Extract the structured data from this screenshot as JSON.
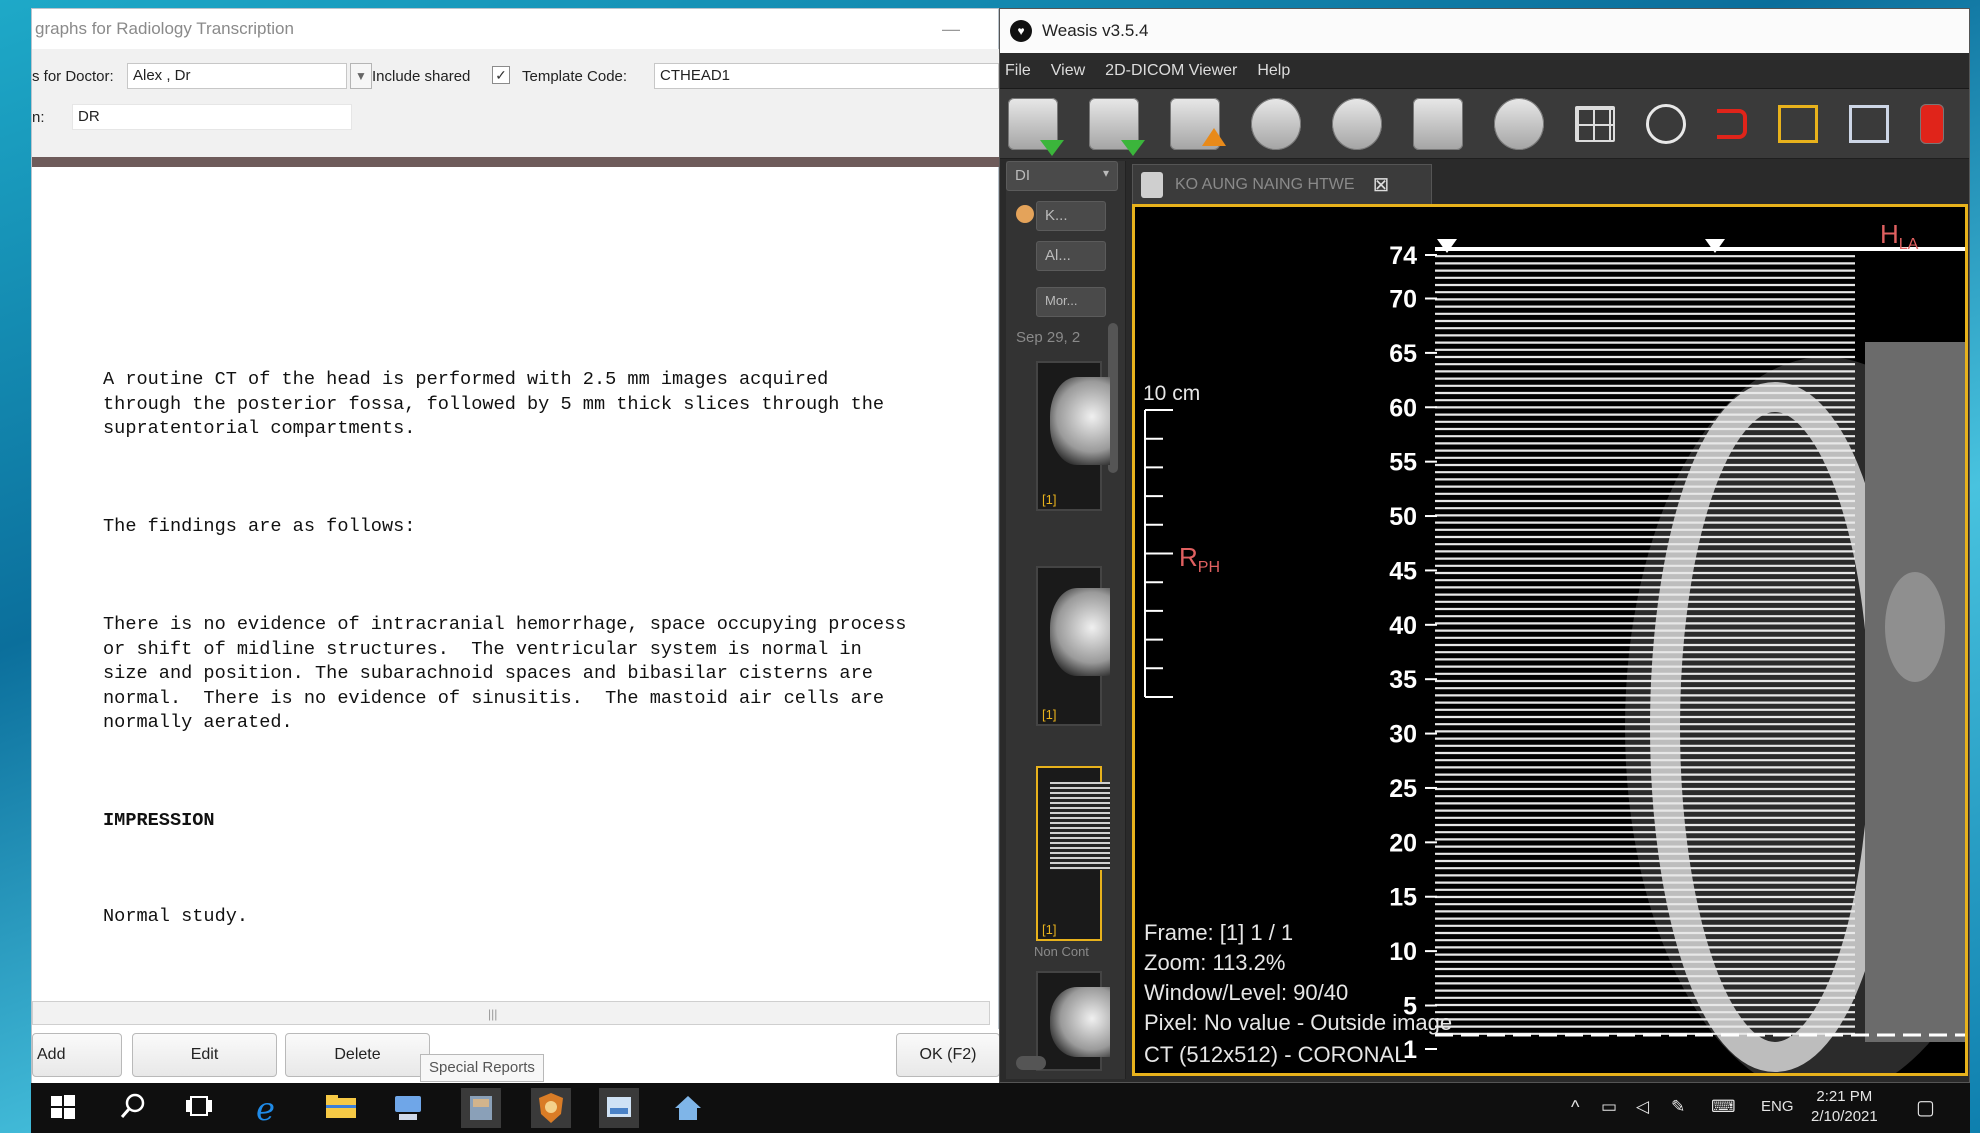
{
  "left_window": {
    "title": "graphs for Radiology Transcription",
    "minimize": "—",
    "doctor_label": "s for Doctor:",
    "doctor_value": "Alex , Dr",
    "include_shared_label": "Include shared",
    "include_shared_checked": "✓",
    "template_code_label": "Template Code:",
    "template_code_value": "CTHEAD1",
    "row2_label": "n:",
    "row2_value": "DR",
    "report": {
      "p1": "A routine CT of the head is performed with 2.5 mm images acquired\nthrough the posterior fossa, followed by 5 mm thick slices through the\nsupratentorial compartments.",
      "p2": "The findings are as follows:",
      "p3": "There is no evidence of intracranial hemorrhage, space occupying process\nor shift of midline structures.  The ventricular system is normal in\nsize and position. The subarachnoid spaces and bibasilar cisterns are\nnormal.  There is no evidence of sinusitis.  The mastoid air cells are\nnormally aerated.",
      "p4": "IMPRESSION",
      "p5": "Normal study."
    },
    "scroll_grip": "|||",
    "buttons": {
      "add": "Add",
      "edit": "Edit",
      "delete": "Delete",
      "ok": "OK (F2)"
    },
    "tooltip": "Special Reports"
  },
  "right_window": {
    "title": "Weasis v3.5.4",
    "menu": [
      "File",
      "View",
      "2D-DICOM Viewer",
      "Help"
    ],
    "side_panel": {
      "dropdown_top": "DI",
      "patient": "K...",
      "all": "Al...",
      "more": "Mor...",
      "date": "Sep 29, 2",
      "thumb_label": "[1]",
      "series_label": "Non Cont"
    },
    "tab_label": "KO AUNG NAING HTWE",
    "viewer": {
      "scale_label": "10 cm",
      "orient_top": "H",
      "orient_top_sub": "LA",
      "orient_left": "R",
      "orient_left_sub": "PH",
      "frame": "Frame: [1] 1 / 1",
      "zoom": "Zoom: 113.2%",
      "window_level": "Window/Level: 90/40",
      "pixel": "Pixel: No value - Outside image",
      "series": "CT (512x512) - CORONAL",
      "ruler_labels": [
        "74",
        "70",
        "65",
        "60",
        "55",
        "50",
        "45",
        "40",
        "35",
        "30",
        "25",
        "20",
        "15",
        "10",
        "5",
        "1"
      ],
      "accent": "#e8b21c"
    }
  },
  "taskbar": {
    "icons": [
      "windows-start-icon",
      "search-icon",
      "task-view-icon",
      "ie-icon",
      "file-explorer-icon",
      "network-icon",
      "app-icon",
      "shield-app-icon",
      "viewer-app-icon",
      "home-app-icon"
    ],
    "lang": "ENG",
    "time": "2:21 PM",
    "date": "2/10/2021"
  }
}
